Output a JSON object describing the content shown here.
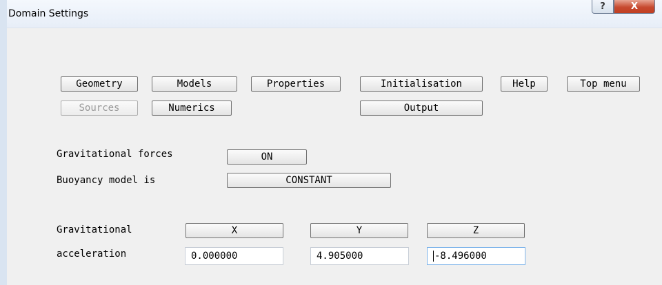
{
  "window": {
    "title": "Domain Settings",
    "help_label": "?",
    "close_label": "X"
  },
  "menu": {
    "geometry": "Geometry",
    "models": "Models",
    "properties": "Properties",
    "initialisation": "Initialisation",
    "help": "Help",
    "top_menu": "Top menu",
    "sources": "Sources",
    "numerics": "Numerics",
    "output": "Output"
  },
  "settings": {
    "grav_forces_label": "Gravitational forces",
    "grav_forces_value": "ON",
    "buoyancy_label": "Buoyancy model is",
    "buoyancy_value": "CONSTANT"
  },
  "acceleration": {
    "label_line1": "Gravitational",
    "label_line2": "acceleration",
    "x_button": "X",
    "y_button": "Y",
    "z_button": "Z",
    "x_value": "0.000000",
    "y_value": "4.905000",
    "z_value": "-8.496000"
  }
}
